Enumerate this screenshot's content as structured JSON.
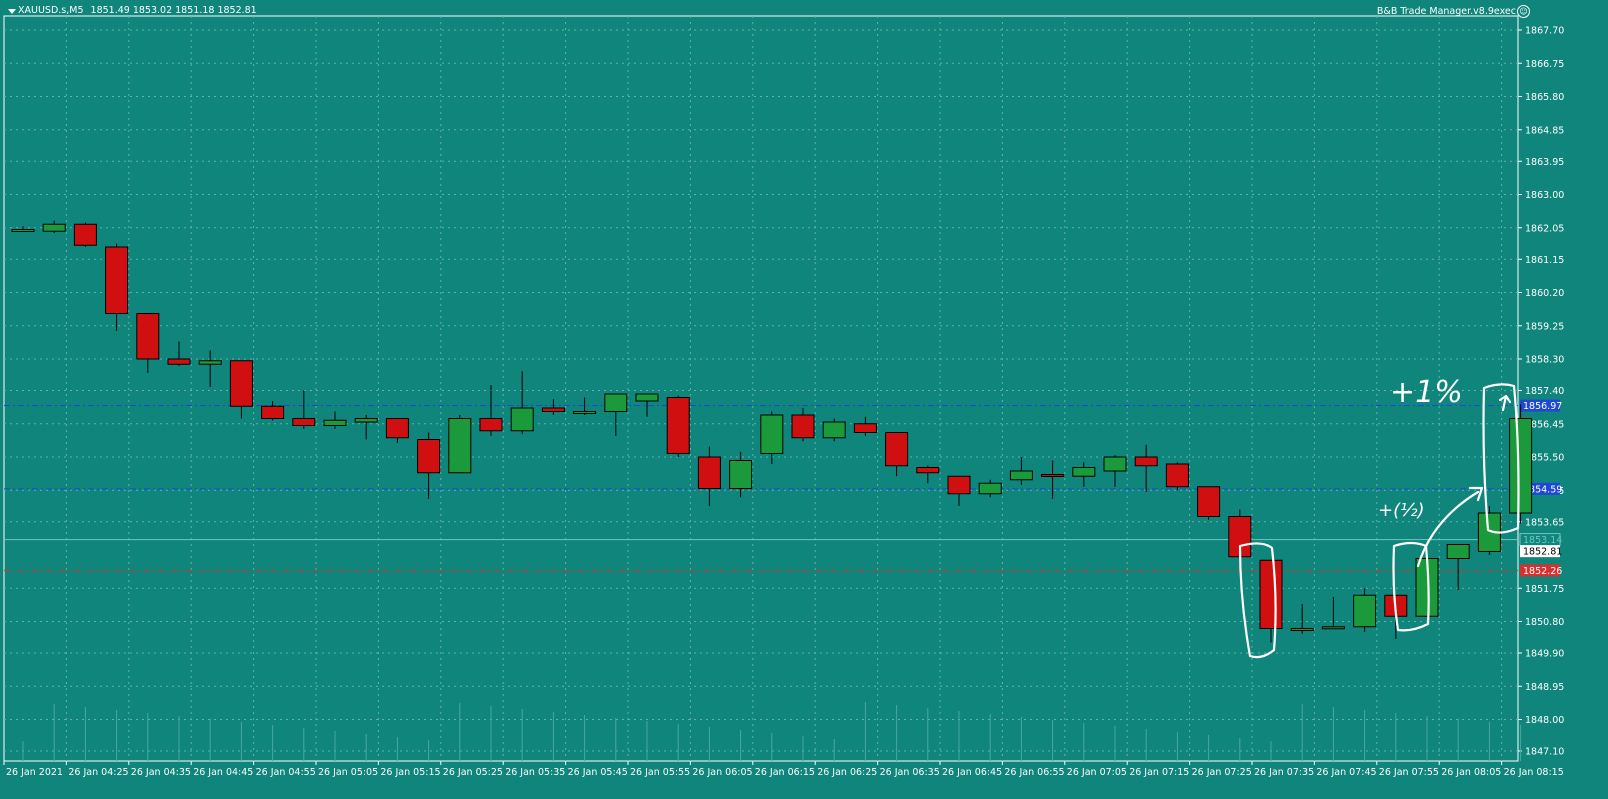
{
  "header": {
    "symbol": "XAUUSD.s,M5",
    "ohlc": "1851.49 1853.02 1851.18 1852.81"
  },
  "ea_label": "B&B Trade Manager.v8.9exec",
  "colors": {
    "background": "#0f857c",
    "grid": "#5fb3ab",
    "bull": "#1b9a3b",
    "bear": "#d01010",
    "axis": "#ffffff",
    "level_line": "#1f47d6",
    "bid_line": "#d63030",
    "ask_line": "#6fc6bf"
  },
  "price_axis": {
    "labels": [
      "1867.70",
      "1866.75",
      "1865.80",
      "1864.85",
      "1863.95",
      "1863.00",
      "1862.05",
      "1861.15",
      "1860.20",
      "1859.25",
      "1858.30",
      "1857.40",
      "1856.45",
      "1855.50",
      "1854.55",
      "1853.65",
      "1851.75",
      "1850.80",
      "1849.90",
      "1848.95",
      "1848.00",
      "1847.10"
    ]
  },
  "time_axis": {
    "labels": [
      "26 Jan 2021",
      "26 Jan 04:25",
      "26 Jan 04:35",
      "26 Jan 04:45",
      "26 Jan 04:55",
      "26 Jan 05:05",
      "26 Jan 05:15",
      "26 Jan 05:25",
      "26 Jan 05:35",
      "26 Jan 05:45",
      "26 Jan 05:55",
      "26 Jan 06:05",
      "26 Jan 06:15",
      "26 Jan 06:25",
      "26 Jan 06:35",
      "26 Jan 06:45",
      "26 Jan 06:55",
      "26 Jan 07:05",
      "26 Jan 07:15",
      "26 Jan 07:25",
      "26 Jan 07:35",
      "26 Jan 07:45",
      "26 Jan 07:55",
      "26 Jan 08:05",
      "26 Jan 08:15"
    ]
  },
  "levels": [
    {
      "name": "upper-level",
      "price": 1856.97,
      "label": "1856.97",
      "color": "#1f47d6"
    },
    {
      "name": "lower-level",
      "price": 1854.59,
      "label": "1854.59",
      "color": "#1f47d6"
    },
    {
      "name": "ask-level",
      "price": 1853.14,
      "label": "1853.14",
      "color": "#6fc6bf"
    },
    {
      "name": "current-price",
      "price": 1852.81,
      "label": "1852.81",
      "color": "#ffffff"
    },
    {
      "name": "bid-level",
      "price": 1852.26,
      "label": "1852.26",
      "color": "#d63030"
    }
  ],
  "chart_data": {
    "type": "candlestick",
    "timeframe": "M5",
    "candles": [
      {
        "o": 1862.0,
        "h": 1862.1,
        "l": 1861.95,
        "c": 1862.0
      },
      {
        "o": 1861.95,
        "h": 1862.25,
        "l": 1861.9,
        "c": 1862.15
      },
      {
        "o": 1862.15,
        "h": 1862.2,
        "l": 1861.5,
        "c": 1861.55
      },
      {
        "o": 1861.5,
        "h": 1861.6,
        "l": 1859.1,
        "c": 1859.6
      },
      {
        "o": 1859.6,
        "h": 1859.6,
        "l": 1857.9,
        "c": 1858.3
      },
      {
        "o": 1858.3,
        "h": 1858.8,
        "l": 1858.1,
        "c": 1858.15
      },
      {
        "o": 1858.15,
        "h": 1858.55,
        "l": 1857.5,
        "c": 1858.25
      },
      {
        "o": 1858.25,
        "h": 1858.25,
        "l": 1856.6,
        "c": 1856.95
      },
      {
        "o": 1856.95,
        "h": 1857.1,
        "l": 1856.55,
        "c": 1856.6
      },
      {
        "o": 1856.6,
        "h": 1857.4,
        "l": 1856.3,
        "c": 1856.4
      },
      {
        "o": 1856.4,
        "h": 1856.8,
        "l": 1856.3,
        "c": 1856.55
      },
      {
        "o": 1856.5,
        "h": 1856.7,
        "l": 1856.0,
        "c": 1856.6
      },
      {
        "o": 1856.6,
        "h": 1856.6,
        "l": 1855.9,
        "c": 1856.05
      },
      {
        "o": 1856.0,
        "h": 1856.2,
        "l": 1854.3,
        "c": 1855.05
      },
      {
        "o": 1855.05,
        "h": 1856.7,
        "l": 1855.05,
        "c": 1856.6
      },
      {
        "o": 1856.6,
        "h": 1857.55,
        "l": 1856.1,
        "c": 1856.25
      },
      {
        "o": 1856.25,
        "h": 1857.95,
        "l": 1856.15,
        "c": 1856.9
      },
      {
        "o": 1856.9,
        "h": 1857.15,
        "l": 1856.7,
        "c": 1856.8
      },
      {
        "o": 1856.8,
        "h": 1857.2,
        "l": 1856.7,
        "c": 1856.8
      },
      {
        "o": 1856.8,
        "h": 1857.1,
        "l": 1856.1,
        "c": 1857.3
      },
      {
        "o": 1857.1,
        "h": 1857.3,
        "l": 1856.65,
        "c": 1857.3
      },
      {
        "o": 1857.2,
        "h": 1857.25,
        "l": 1855.5,
        "c": 1855.6
      },
      {
        "o": 1855.5,
        "h": 1855.8,
        "l": 1854.1,
        "c": 1854.6
      },
      {
        "o": 1854.6,
        "h": 1855.65,
        "l": 1854.35,
        "c": 1855.4
      },
      {
        "o": 1855.6,
        "h": 1856.8,
        "l": 1855.3,
        "c": 1856.7
      },
      {
        "o": 1856.7,
        "h": 1856.9,
        "l": 1855.95,
        "c": 1856.05
      },
      {
        "o": 1856.05,
        "h": 1856.6,
        "l": 1855.95,
        "c": 1856.5
      },
      {
        "o": 1856.45,
        "h": 1856.65,
        "l": 1856.1,
        "c": 1856.2
      },
      {
        "o": 1856.2,
        "h": 1856.2,
        "l": 1854.95,
        "c": 1855.25
      },
      {
        "o": 1855.2,
        "h": 1855.25,
        "l": 1854.75,
        "c": 1855.05
      },
      {
        "o": 1854.95,
        "h": 1854.95,
        "l": 1854.1,
        "c": 1854.45
      },
      {
        "o": 1854.45,
        "h": 1854.85,
        "l": 1854.35,
        "c": 1854.75
      },
      {
        "o": 1854.85,
        "h": 1855.5,
        "l": 1854.7,
        "c": 1855.1
      },
      {
        "o": 1855.0,
        "h": 1855.4,
        "l": 1854.3,
        "c": 1854.95
      },
      {
        "o": 1854.95,
        "h": 1855.35,
        "l": 1854.65,
        "c": 1855.2
      },
      {
        "o": 1855.1,
        "h": 1855.55,
        "l": 1854.65,
        "c": 1855.5
      },
      {
        "o": 1855.5,
        "h": 1855.85,
        "l": 1854.5,
        "c": 1855.25
      },
      {
        "o": 1855.3,
        "h": 1855.35,
        "l": 1854.55,
        "c": 1854.65
      },
      {
        "o": 1854.65,
        "h": 1854.65,
        "l": 1853.7,
        "c": 1853.8
      },
      {
        "o": 1853.8,
        "h": 1854.0,
        "l": 1852.4,
        "c": 1852.65
      },
      {
        "o": 1852.55,
        "h": 1852.55,
        "l": 1850.2,
        "c": 1850.6
      },
      {
        "o": 1850.6,
        "h": 1851.3,
        "l": 1850.45,
        "c": 1850.6
      },
      {
        "o": 1850.6,
        "h": 1851.5,
        "l": 1850.6,
        "c": 1850.65
      },
      {
        "o": 1850.65,
        "h": 1851.75,
        "l": 1850.5,
        "c": 1851.55
      },
      {
        "o": 1851.55,
        "h": 1851.55,
        "l": 1850.3,
        "c": 1850.95
      },
      {
        "o": 1850.95,
        "h": 1852.6,
        "l": 1850.95,
        "c": 1852.6
      },
      {
        "o": 1852.6,
        "h": 1853.0,
        "l": 1851.7,
        "c": 1853.0
      },
      {
        "o": 1852.8,
        "h": 1854.1,
        "l": 1852.7,
        "c": 1853.9
      },
      {
        "o": 1853.9,
        "h": 1857.0,
        "l": 1853.6,
        "c": 1856.6
      }
    ]
  },
  "annotations": {
    "plus_percent": "+1%",
    "scribble": "+(½)"
  }
}
